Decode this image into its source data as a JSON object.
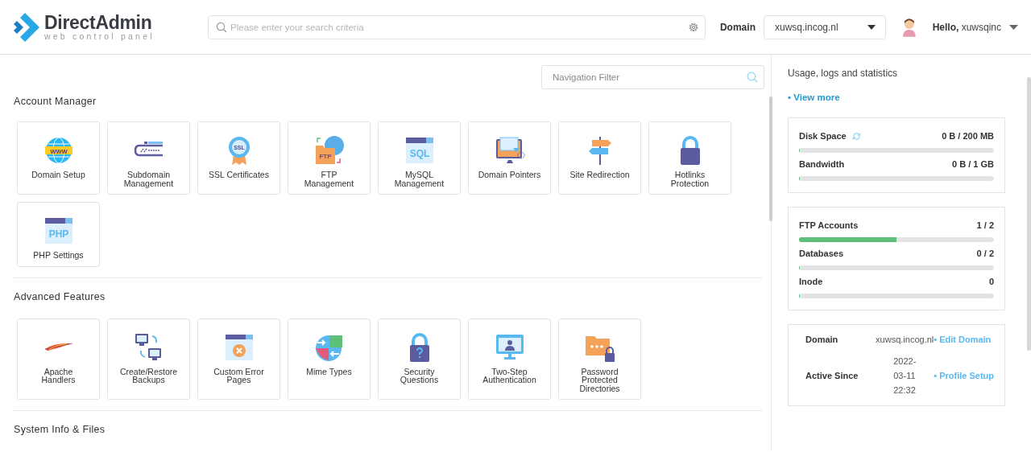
{
  "header": {
    "logo": {
      "name": "DirectAdmin",
      "tagline": "web control panel"
    },
    "search": {
      "placeholder": "Please enter your search criteria"
    },
    "domain_label": "Domain",
    "domain_select": {
      "value": "xuwsq.incog.nl"
    },
    "user_greeting": "**Hello,** xuwsqinc"
  },
  "navigation_filter": {
    "placeholder": "Navigation Filter"
  },
  "sections": [
    {
      "title": "Account Manager",
      "tiles": [
        {
          "label": "Domain Setup",
          "icon_text": "WWW"
        },
        {
          "label": "Subdomain Management"
        },
        {
          "label": "SSL Certificates",
          "icon_text": "SSL"
        },
        {
          "label": "FTP Management",
          "icon_text": "FTP"
        },
        {
          "label": "MySQL Management",
          "icon_text": "SQL"
        },
        {
          "label": "Domain Pointers"
        },
        {
          "label": "Site Redirection"
        },
        {
          "label": "Hotlinks Protection"
        },
        {
          "label": "PHP Settings",
          "icon_text": "PHP"
        }
      ]
    },
    {
      "title": "Advanced Features",
      "tiles": [
        {
          "label": "Apache Handlers"
        },
        {
          "label": "Create/Restore Backups"
        },
        {
          "label": "Custom Error Pages"
        },
        {
          "label": "Mime Types"
        },
        {
          "label": "Security Questions"
        },
        {
          "label": "Two-Step Authentication"
        },
        {
          "label": "Password Protected Directories"
        }
      ]
    },
    {
      "title": "System Info & Files"
    }
  ],
  "sidebar": {
    "title": "Usage, logs and statistics",
    "link": "• View more",
    "meter_groups": [
      [
        {
          "name": "Disk Space",
          "reading": "0 B / 200 MB",
          "level": 0,
          "refreshing": true
        },
        {
          "name": "Bandwidth",
          "reading": "0 B / 1 GB",
          "level": 0,
          "refreshing": false
        }
      ],
      [
        {
          "name": "FTP Accounts",
          "reading": "1 / 2",
          "level": 0.5,
          "refreshing": false
        },
        {
          "name": "Databases",
          "reading": "0 / 2",
          "level": 0,
          "refreshing": false
        },
        {
          "name": "Inode",
          "reading": "0",
          "level": 0,
          "refreshing": false
        }
      ]
    ],
    "info": [
      {
        "label": "Domain",
        "value": "xuwsq.incog.nl",
        "link": "• Edit Domain"
      },
      {
        "label": "Active Since",
        "value": "2022-03-11 22:32",
        "link": "• Profile Setup"
      }
    ]
  }
}
